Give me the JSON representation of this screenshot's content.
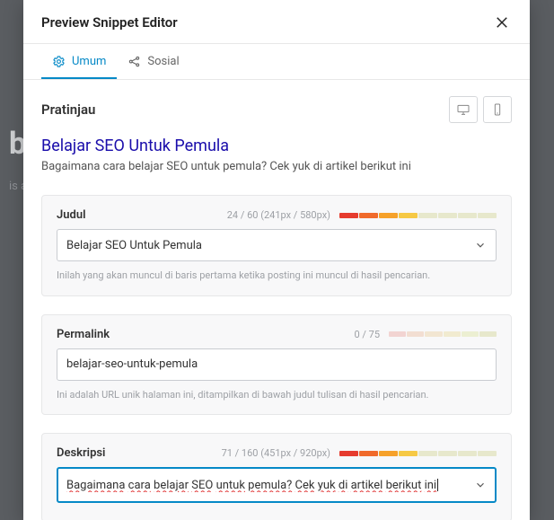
{
  "modal": {
    "title": "Preview Snippet Editor",
    "tabs": {
      "general": "Umum",
      "social": "Sosial"
    }
  },
  "preview": {
    "label": "Pratinjau",
    "serp_title": "Belajar SEO Untuk Pemula",
    "serp_description": "Bagaimana cara belajar SEO untuk pemula? Cek yuk di artikel berikut ini"
  },
  "fields": {
    "title": {
      "label": "Judul",
      "counter": "24 / 60 (241px / 580px)",
      "value": "Belajar SEO Untuk Pemula",
      "help": "Inilah yang akan muncul di baris pertama ketika posting ini muncul di hasil pencarian."
    },
    "permalink": {
      "label": "Permalink",
      "counter": "0 / 75",
      "value": "belajar-seo-untuk-pemula",
      "help": "Ini adalah URL unik halaman ini, ditampilkan di bawah judul tulisan di hasil pencarian."
    },
    "description": {
      "label": "Deskripsi",
      "counter": "71 / 160 (451px / 920px)",
      "words": [
        "Bagaimana",
        "cara",
        "belajar",
        "SEO",
        "untuk",
        "pemula?",
        "Cek",
        "yuk",
        "di",
        "artikel",
        "berikut",
        "ini"
      ]
    }
  }
}
